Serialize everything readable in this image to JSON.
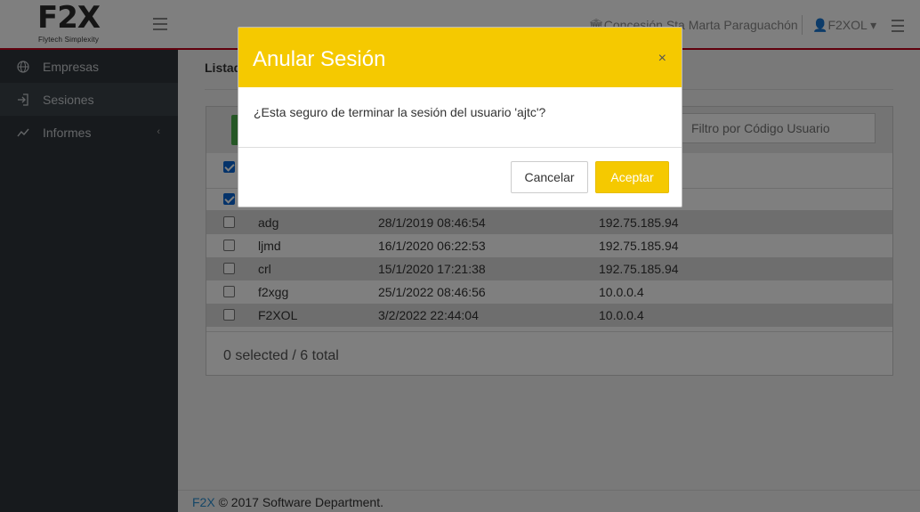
{
  "header": {
    "logo_text": "F2X",
    "logo_tagline": "Flytech  Simplexity",
    "organization": "Concesión Sta Marta Paraguachón",
    "user": "F2XOL"
  },
  "sidebar": {
    "items": [
      {
        "label": "Empresas",
        "icon": "globe-icon"
      },
      {
        "label": "Sesiones",
        "icon": "sign-in-icon"
      },
      {
        "label": "Informes",
        "icon": "line-chart-icon",
        "chevron": "‹"
      }
    ]
  },
  "main": {
    "page_title": "Listado",
    "filter_placeholder": "Filtro por Código Usuario",
    "rows": [
      {
        "user": "adg",
        "date": "28/1/2019 08:46:54",
        "ip": "192.75.185.94"
      },
      {
        "user": "ljmd",
        "date": "16/1/2020 06:22:53",
        "ip": "192.75.185.94"
      },
      {
        "user": "crl",
        "date": "15/1/2020 17:21:38",
        "ip": "192.75.185.94"
      },
      {
        "user": "f2xgg",
        "date": "25/1/2022 08:46:56",
        "ip": "10.0.0.4"
      },
      {
        "user": "F2XOL",
        "date": "3/2/2022 22:44:04",
        "ip": "10.0.0.4"
      }
    ],
    "summary": "0 selected / 6 total"
  },
  "modal": {
    "title": "Anular Sesión",
    "close": "×",
    "message": "¿Esta seguro de terminar la sesión del usuario 'ajtc'?",
    "cancel_label": "Cancelar",
    "ok_label": "Aceptar"
  },
  "footer": {
    "brand": "F2X",
    "text": " © 2017 Software Department."
  },
  "colors": {
    "accent_yellow": "#f5c900",
    "sidebar_bg": "#2f353a",
    "brand_red": "#c0001a",
    "link_blue": "#2a8fd1"
  }
}
